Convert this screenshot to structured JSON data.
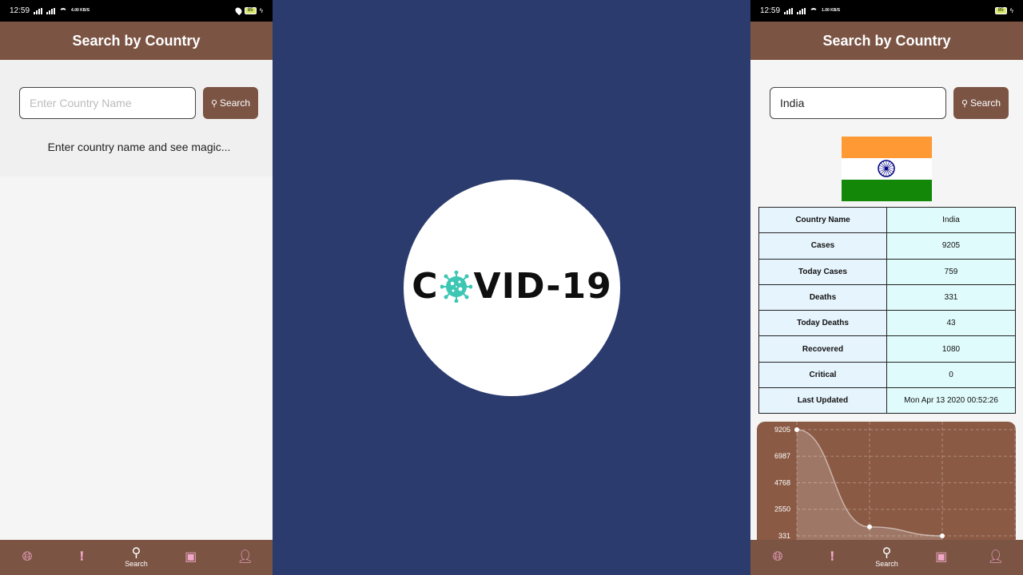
{
  "status": {
    "left_time": "12:59",
    "left_net": "4.00 KB/S",
    "left_battery": "85",
    "right_time": "12:59",
    "right_net": "1.00 KB/S",
    "right_battery": "85"
  },
  "left": {
    "title": "Search by Country",
    "search_placeholder": "Enter Country Name",
    "search_value": "",
    "search_label": "Search",
    "hint": "Enter country name and see magic..."
  },
  "splash": {
    "logo_left": "C",
    "logo_right": "VID-19"
  },
  "right": {
    "title": "Search by Country",
    "search_value": "India",
    "search_label": "Search",
    "flag_colors": [
      "#ff9933",
      "#ffffff",
      "#138808"
    ],
    "stats": [
      {
        "label": "Country Name",
        "value": "India"
      },
      {
        "label": "Cases",
        "value": "9205"
      },
      {
        "label": "Today Cases",
        "value": "759"
      },
      {
        "label": "Deaths",
        "value": "331"
      },
      {
        "label": "Today Deaths",
        "value": "43"
      },
      {
        "label": "Recovered",
        "value": "1080"
      },
      {
        "label": "Critical",
        "value": "0"
      },
      {
        "label": "Last Updated",
        "value": "Mon Apr 13 2020 00:52:26"
      }
    ]
  },
  "chart_data": {
    "type": "area",
    "x": [
      0,
      1,
      2
    ],
    "values": [
      9205,
      1080,
      331
    ],
    "yticks": [
      "9205",
      "6987",
      "4768",
      "2550",
      "331"
    ],
    "ylim": [
      331,
      9205
    ],
    "grid": true
  },
  "nav": {
    "items": [
      {
        "icon": "globe-icon",
        "label": ""
      },
      {
        "icon": "alert-icon",
        "label": ""
      },
      {
        "icon": "search-icon",
        "label": "Search"
      },
      {
        "icon": "image-icon",
        "label": ""
      },
      {
        "icon": "user-icon",
        "label": ""
      }
    ]
  },
  "colors": {
    "primary": "#7b5444",
    "splash_bg": "#2b3b6d",
    "accent_pink": "#f1a7c6",
    "virus": "#3cc6b4"
  }
}
